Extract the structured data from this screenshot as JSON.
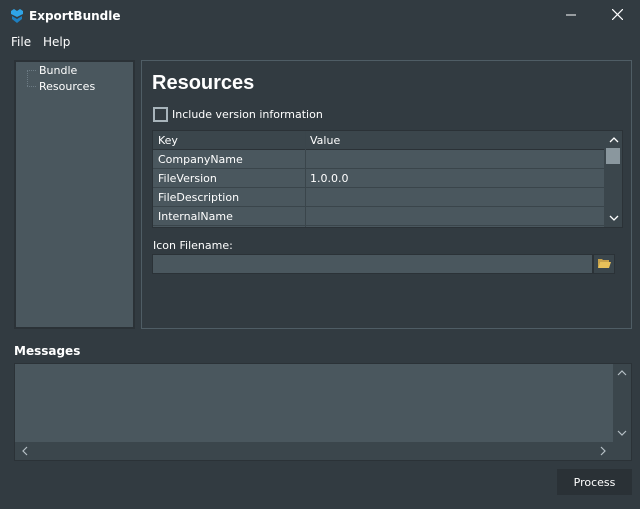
{
  "window": {
    "title": "ExportBundle",
    "icon": "app-logo-icon",
    "minimize_icon": "minimize-icon",
    "close_icon": "close-icon"
  },
  "menu": {
    "file": "File",
    "help": "Help"
  },
  "tree": {
    "items": [
      {
        "label": "Bundle"
      },
      {
        "label": "Resources"
      }
    ]
  },
  "resources": {
    "title": "Resources",
    "include_version_label": "Include version information",
    "include_version_checked": false,
    "grid": {
      "columns": [
        "Key",
        "Value"
      ],
      "rows": [
        {
          "key": "CompanyName",
          "value": ""
        },
        {
          "key": "FileVersion",
          "value": "1.0.0.0"
        },
        {
          "key": "FileDescription",
          "value": ""
        },
        {
          "key": "InternalName",
          "value": ""
        }
      ]
    },
    "icon_filename_label": "Icon Filename:",
    "icon_filename_value": "",
    "browse_icon": "folder-open-icon"
  },
  "messages": {
    "label": "Messages",
    "content": ""
  },
  "actions": {
    "process_label": "Process"
  },
  "colors": {
    "background": "#323b41",
    "panel": "#4a575e",
    "header": "#3b464c",
    "accent": "#2fa4e7",
    "folder": "#e8c15a"
  }
}
